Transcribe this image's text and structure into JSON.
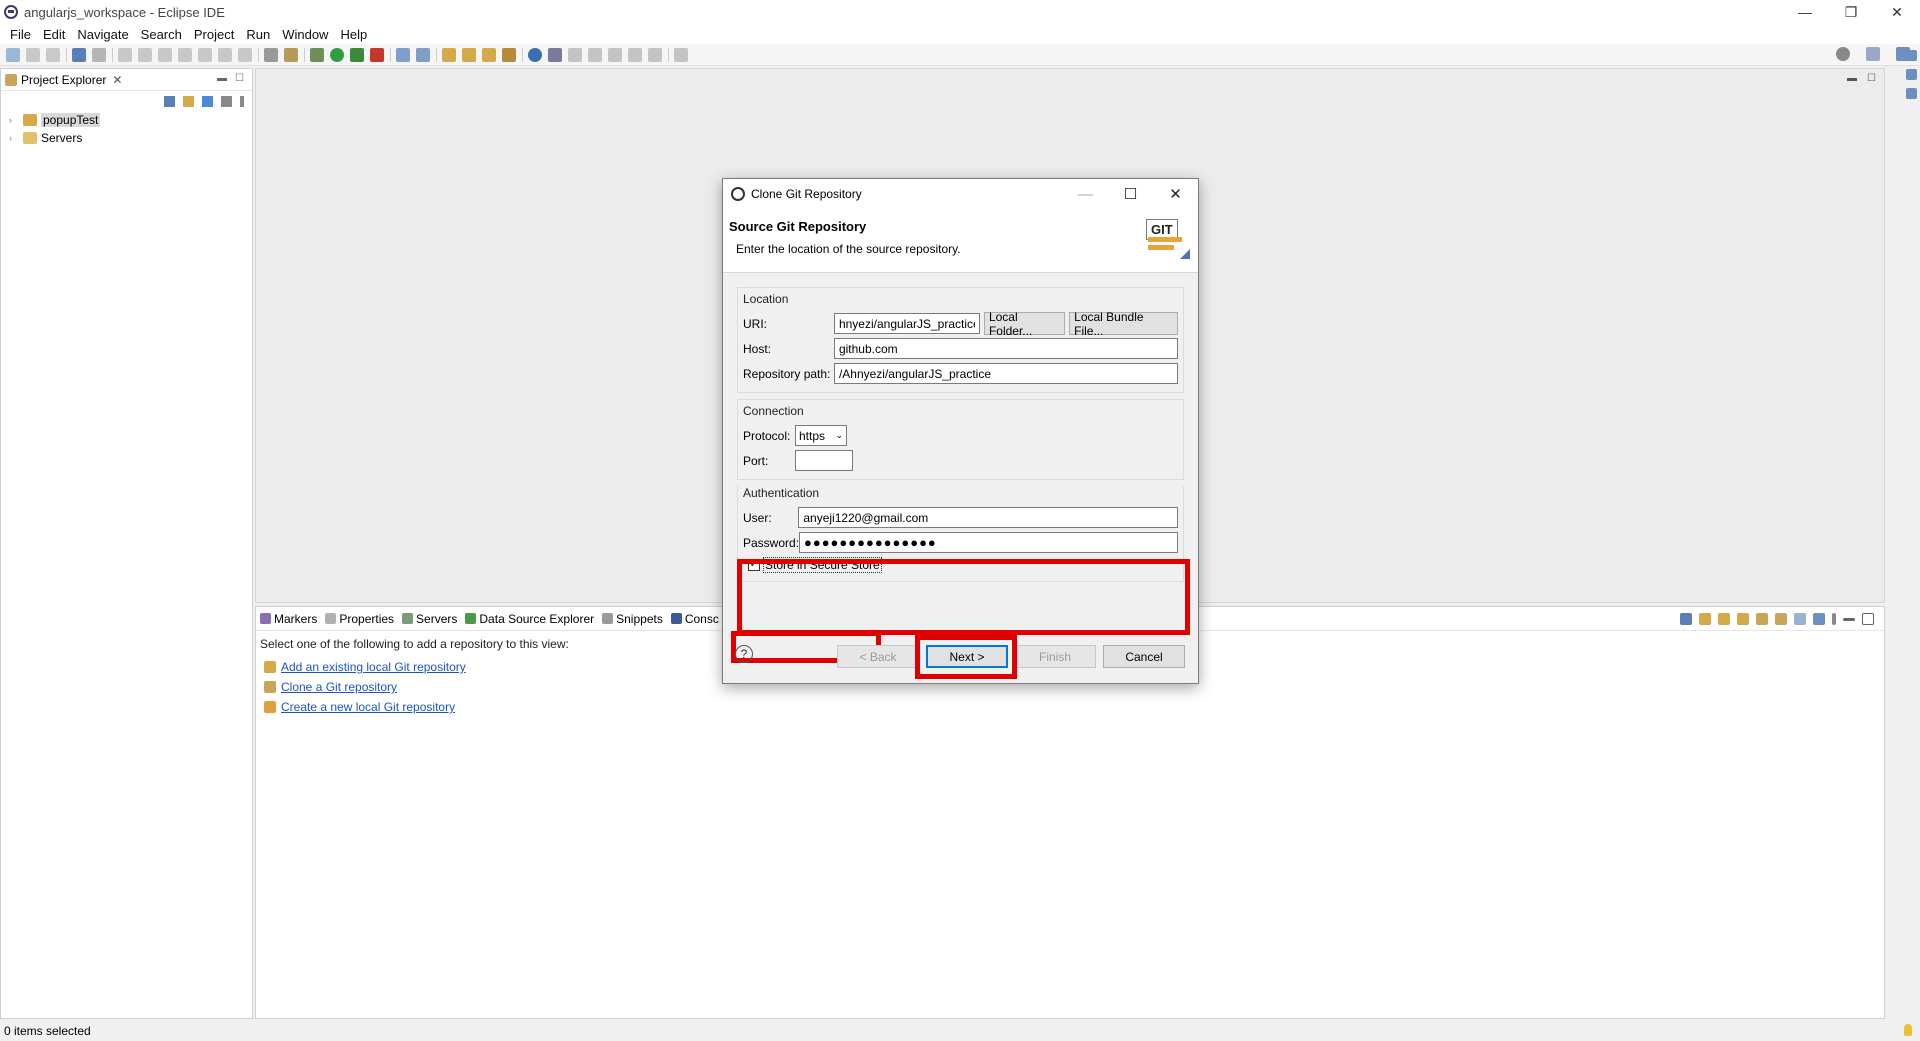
{
  "window": {
    "title": "angularjs_workspace - Eclipse IDE",
    "controls": [
      "—",
      "❐",
      "✕"
    ]
  },
  "menu": [
    "File",
    "Edit",
    "Navigate",
    "Search",
    "Project",
    "Run",
    "Window",
    "Help"
  ],
  "project_explorer": {
    "tab_label": "Project Explorer",
    "close": "✕",
    "items": [
      {
        "label": "popupTest",
        "selected": true
      },
      {
        "label": "Servers",
        "selected": false
      }
    ]
  },
  "bottom_views": {
    "tabs": [
      "Markers",
      "Properties",
      "Servers",
      "Data Source Explorer",
      "Snippets",
      "Consc"
    ],
    "message": "Select one of the following to add a repository to this view:",
    "links": [
      "Add an existing local Git repository",
      "Clone a Git repository",
      "Create a new local Git repository"
    ]
  },
  "status_bar": {
    "text": "0 items selected"
  },
  "dialog": {
    "title": "Clone Git Repository",
    "header_title": "Source Git Repository",
    "header_subtitle": "Enter the location of the source repository.",
    "logo_text": "GIT",
    "location": {
      "legend": "Location",
      "uri_label": "URI:",
      "uri_value": "hnyezi/angularJS_practice",
      "local_folder_btn": "Local Folder...",
      "local_bundle_btn": "Local Bundle File...",
      "host_label": "Host:",
      "host_value": "github.com",
      "repo_path_label": "Repository path:",
      "repo_path_value": "/Ahnyezi/angularJS_practice"
    },
    "connection": {
      "legend": "Connection",
      "protocol_label": "Protocol:",
      "protocol_value": "https",
      "port_label": "Port:",
      "port_value": ""
    },
    "authentication": {
      "legend": "Authentication",
      "user_label": "User:",
      "user_value": "anyeji1220@gmail.com",
      "password_label": "Password:",
      "password_value": "●●●●●●●●●●●●●●●"
    },
    "store_secure": {
      "label": "Store in Secure Store",
      "checked": true
    },
    "buttons": {
      "help": "?",
      "back": "< Back",
      "next": "Next >",
      "finish": "Finish",
      "cancel": "Cancel"
    }
  },
  "colors": {
    "highlight_red": "#e00000",
    "link_blue": "#1a55c8",
    "default_button_border": "#0078d7"
  }
}
